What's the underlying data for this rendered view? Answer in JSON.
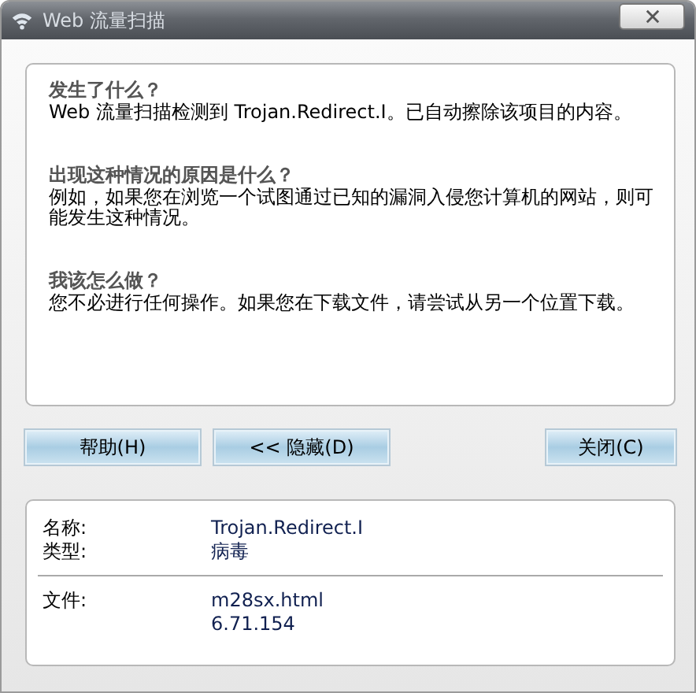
{
  "window": {
    "title": "Web 流量扫描"
  },
  "sections": [
    {
      "heading": "发生了什么？",
      "text": "Web 流量扫描检测到 Trojan.Redirect.I。已自动擦除该项目的内容。"
    },
    {
      "heading": "出现这种情况的原因是什么？",
      "text": "例如，如果您在浏览一个试图通过已知的漏洞入侵您计算机的网站，则可能发生这种情况。"
    },
    {
      "heading": "我该怎么做？",
      "text": "您不必进行任何操作。如果您在下载文件，请尝试从另一个位置下载。"
    }
  ],
  "buttons": [
    {
      "label": "帮助(H)",
      "kind": "left"
    },
    {
      "label": "<< 隐藏(D)",
      "kind": "left"
    },
    {
      "label": "关闭(C)",
      "kind": "right"
    }
  ],
  "details": [
    [
      {
        "label": "名称:",
        "value": "Trojan.Redirect.I"
      },
      {
        "label": "类型:",
        "value": "病毒"
      }
    ],
    [
      {
        "label": "文件:",
        "value": "m28sx.html"
      },
      {
        "value": "6.71.154"
      }
    ]
  ]
}
